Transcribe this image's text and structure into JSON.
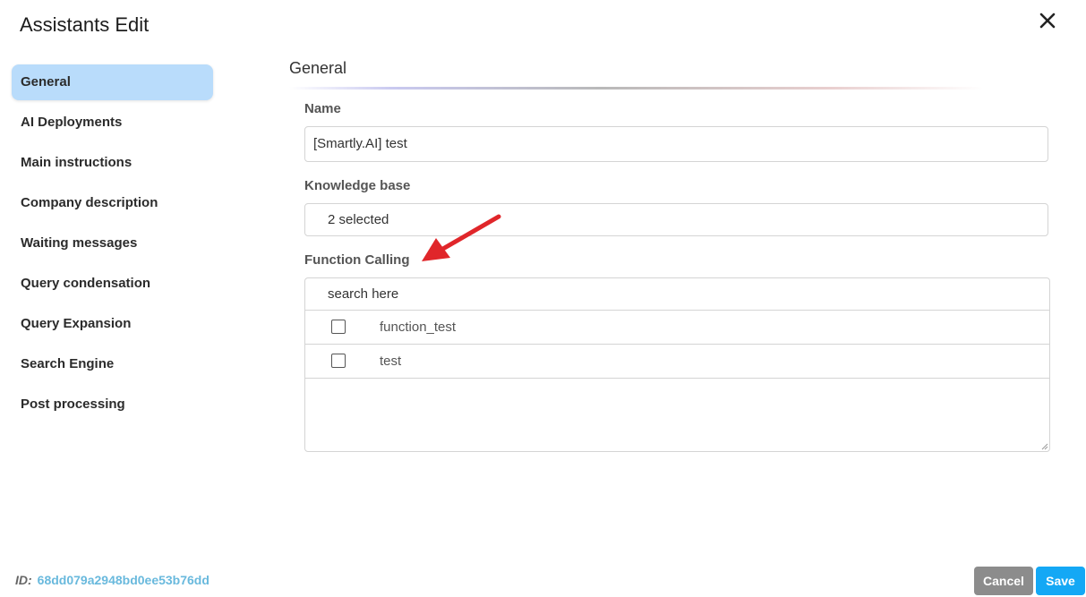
{
  "dialog": {
    "title": "Assistants Edit"
  },
  "sidebar": {
    "items": [
      {
        "label": "General",
        "active": true
      },
      {
        "label": "AI Deployments"
      },
      {
        "label": "Main instructions"
      },
      {
        "label": "Company description"
      },
      {
        "label": "Waiting messages"
      },
      {
        "label": "Query condensation"
      },
      {
        "label": "Query Expansion"
      },
      {
        "label": "Search Engine"
      },
      {
        "label": "Post processing"
      }
    ]
  },
  "main": {
    "section_title": "General",
    "name": {
      "label": "Name",
      "value": "[Smartly.AI] test"
    },
    "knowledge_base": {
      "label": "Knowledge base",
      "value": "2 selected"
    },
    "function_calling": {
      "label": "Function Calling",
      "search_placeholder": "search here",
      "items": [
        {
          "label": "function_test",
          "checked": false
        },
        {
          "label": "test",
          "checked": false
        }
      ]
    }
  },
  "footer": {
    "id_label": "ID:",
    "id_value": "68dd079a2948bd0ee53b76dd",
    "cancel_label": "Cancel",
    "save_label": "Save"
  },
  "colors": {
    "active_nav": "#b9dcfb",
    "save_button": "#14a8f5",
    "cancel_button": "#8c8c8c",
    "id_value": "#69b9dd",
    "annotation_arrow": "#e0262a"
  },
  "icons": {
    "close": "close-icon",
    "annotation": "red-arrow-annotation"
  }
}
